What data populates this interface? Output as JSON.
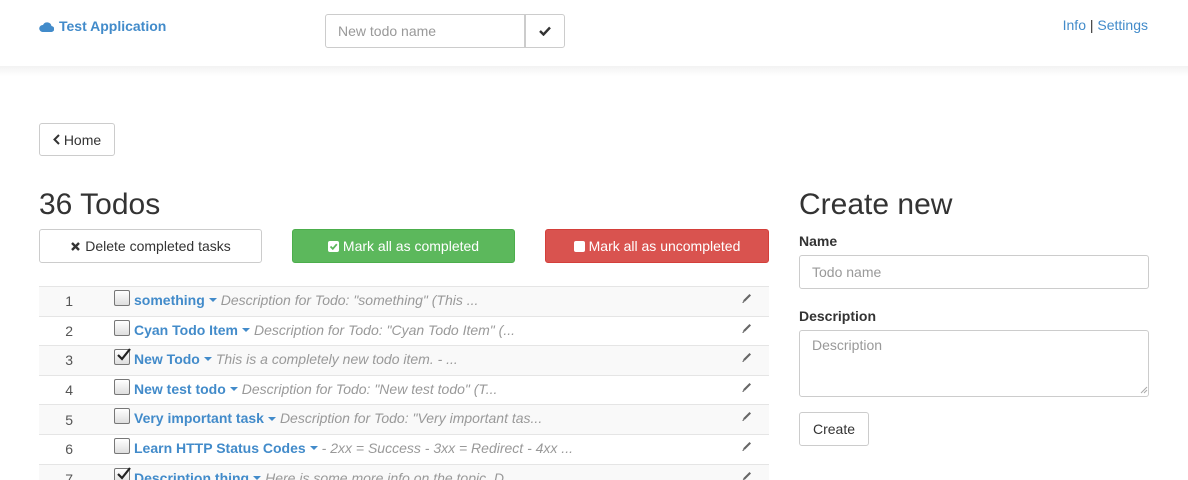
{
  "navbar": {
    "brand": "Test Application",
    "new_todo_placeholder": "New todo name",
    "links": {
      "info": "Info",
      "separator": "|",
      "settings": "Settings"
    }
  },
  "home_button": "Home",
  "todos": {
    "title": "36 Todos",
    "delete_completed_label": "Delete completed tasks",
    "mark_all_completed_label": "Mark all as completed",
    "mark_all_uncompleted_label": "Mark all as uncompleted",
    "items": [
      {
        "num": "1",
        "checked": false,
        "name": "something",
        "description": "Description for Todo: \"something\" (This ..."
      },
      {
        "num": "2",
        "checked": false,
        "name": "Cyan Todo Item",
        "description": "Description for Todo: \"Cyan Todo Item\" (..."
      },
      {
        "num": "3",
        "checked": true,
        "name": "New Todo",
        "description": "This is a completely new todo item. - ..."
      },
      {
        "num": "4",
        "checked": false,
        "name": "New test todo",
        "description": "Description for Todo: \"New test todo\" (T..."
      },
      {
        "num": "5",
        "checked": false,
        "name": "Very important task",
        "description": "Description for Todo: \"Very important tas..."
      },
      {
        "num": "6",
        "checked": false,
        "name": "Learn HTTP Status Codes",
        "description": "- 2xx = Success - 3xx = Redirect - 4xx ..."
      },
      {
        "num": "7",
        "checked": true,
        "name": "Description thing",
        "description": "Here is some more info on the topic. D..."
      }
    ]
  },
  "create_form": {
    "title": "Create new",
    "name_label": "Name",
    "name_placeholder": "Todo name",
    "description_label": "Description",
    "description_placeholder": "Description",
    "submit_label": "Create"
  },
  "colors": {
    "link": "#428bca",
    "success": "#5cb85c",
    "danger": "#d9534f"
  }
}
